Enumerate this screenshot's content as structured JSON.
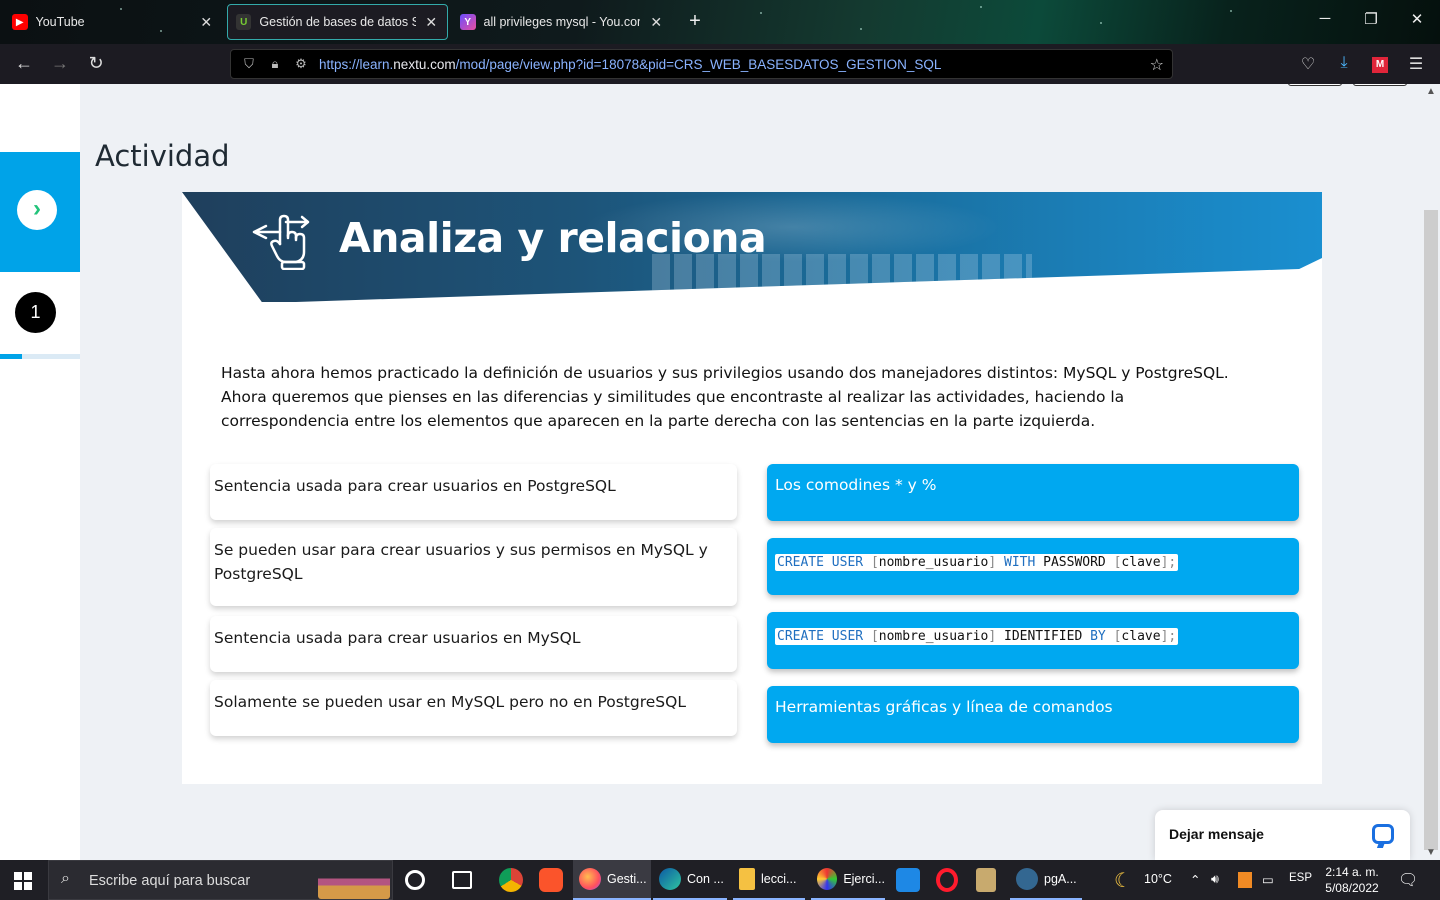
{
  "browser": {
    "tabs": [
      {
        "title": "YouTube",
        "icon": "youtube-icon",
        "active": false
      },
      {
        "title": "Gestión de bases de datos SQL:",
        "icon": "nextu-icon",
        "active": true
      },
      {
        "title": "all privileges mysql - You.com |",
        "icon": "youcom-icon",
        "active": false
      }
    ],
    "new_tab_label": "+",
    "url_prefix": "https://learn.",
    "url_domain": "nextu.com",
    "url_path": "/mod/page/view.php?id=18078&pid=CRS_WEB_BASESDATOS_GESTION_SQL"
  },
  "sidebar": {
    "next_arrow": "›",
    "step_number": "1",
    "progress_fraction": 0.28
  },
  "page": {
    "title": "Actividad",
    "banner_title": "Analiza y relaciona",
    "intro": "Hasta ahora hemos practicado la definición de usuarios y sus privilegios usando dos manejadores distintos: MySQL y PostgreSQL. Ahora queremos que pienses en las diferencias y similitudes que encontraste al realizar las actividades, haciendo la correspondencia entre los elementos que aparecen en la parte derecha con las sentencias en la parte izquierda.",
    "left_items": [
      "Sentencia usada para crear usuarios en PostgreSQL",
      "Se pueden usar para crear usuarios y sus permisos en MySQL y PostgreSQL",
      "Sentencia usada para crear usuarios en MySQL",
      "Solamente se pueden usar en MySQL pero no en PostgreSQL"
    ],
    "right_items": {
      "r0": "Los comodines * y %",
      "r1": {
        "k1": "CREATE",
        "k2": "USER",
        "b1": "[",
        "arg1": "nombre_usuario",
        "b2": "]",
        "k3": "WITH",
        "k4": "PASSWORD",
        "b3": "[",
        "arg2": "clave",
        "b4": "];"
      },
      "r2": {
        "k1": "CREATE",
        "k2": "USER",
        "b1": "[",
        "arg1": "nombre_usuario",
        "b2": "]",
        "k3": "IDENTIFIED",
        "k4": "BY",
        "b3": "[",
        "arg2": "clave",
        "b4": "];"
      },
      "r3": "Herramientas gráficas y línea de comandos"
    }
  },
  "chat": {
    "label": "Dejar mensaje"
  },
  "taskbar": {
    "search_placeholder": "Escribe aquí para buscar",
    "apps": [
      {
        "label": "Gesti...",
        "icon": "firefox-icon"
      },
      {
        "label": "Con ...",
        "icon": "edge-icon"
      },
      {
        "label": "lecci...",
        "icon": "folder-icon"
      },
      {
        "label": "Ejerci...",
        "icon": "paint-icon"
      },
      {
        "label": "pgA...",
        "icon": "pgadmin-icon"
      }
    ],
    "weather": "10°C",
    "language": "ESP",
    "time": "2:14 a. m.",
    "date": "5/08/2022"
  },
  "colors": {
    "accent_blue": "#00a8f0",
    "sidebar_blue": "#00a3e8",
    "arrow_green": "#22c37a"
  }
}
